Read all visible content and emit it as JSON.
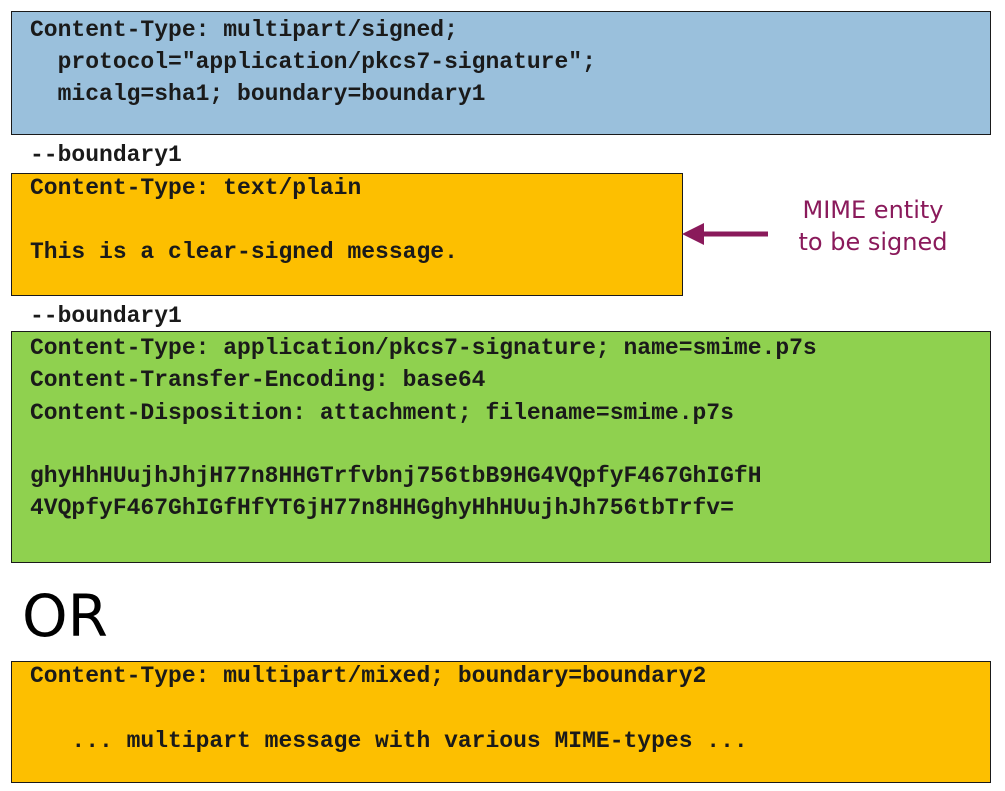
{
  "colors": {
    "header_box": "#9ac0dc",
    "plain_box": "#fdbf00",
    "signature_box": "#8fd14f",
    "mixed_box": "#fdbf00",
    "annotation": "#8a1a5b"
  },
  "header": {
    "line1": "Content-Type: multipart/signed;",
    "line2": "  protocol=\"application/pkcs7-signature\";",
    "line3": "  micalg=sha1; boundary=boundary1"
  },
  "boundary1_label": "--boundary1",
  "boundary2_label": "--boundary1",
  "plain_part": {
    "line1": "Content-Type: text/plain",
    "line2": "This is a clear-signed message."
  },
  "annotation": {
    "line1": "MIME entity",
    "line2": "to be signed",
    "arrow_icon": "arrow-left-icon"
  },
  "signature_part": {
    "line1": "Content-Type: application/pkcs7-signature; name=smime.p7s",
    "line2": "Content-Transfer-Encoding: base64",
    "line3": "Content-Disposition: attachment; filename=smime.p7s",
    "line4": "ghyHhHUujhJhjH77n8HHGTrfvbnj756tbB9HG4VQpfyF467GhIGfH",
    "line5": "4VQpfyF467GhIGfHfYT6jH77n8HHGghyHhHUujhJh756tbTrfv="
  },
  "or_label": "OR",
  "mixed_part": {
    "line1": "Content-Type: multipart/mixed; boundary=boundary2",
    "line2": "   ... multipart message with various MIME-types ..."
  }
}
